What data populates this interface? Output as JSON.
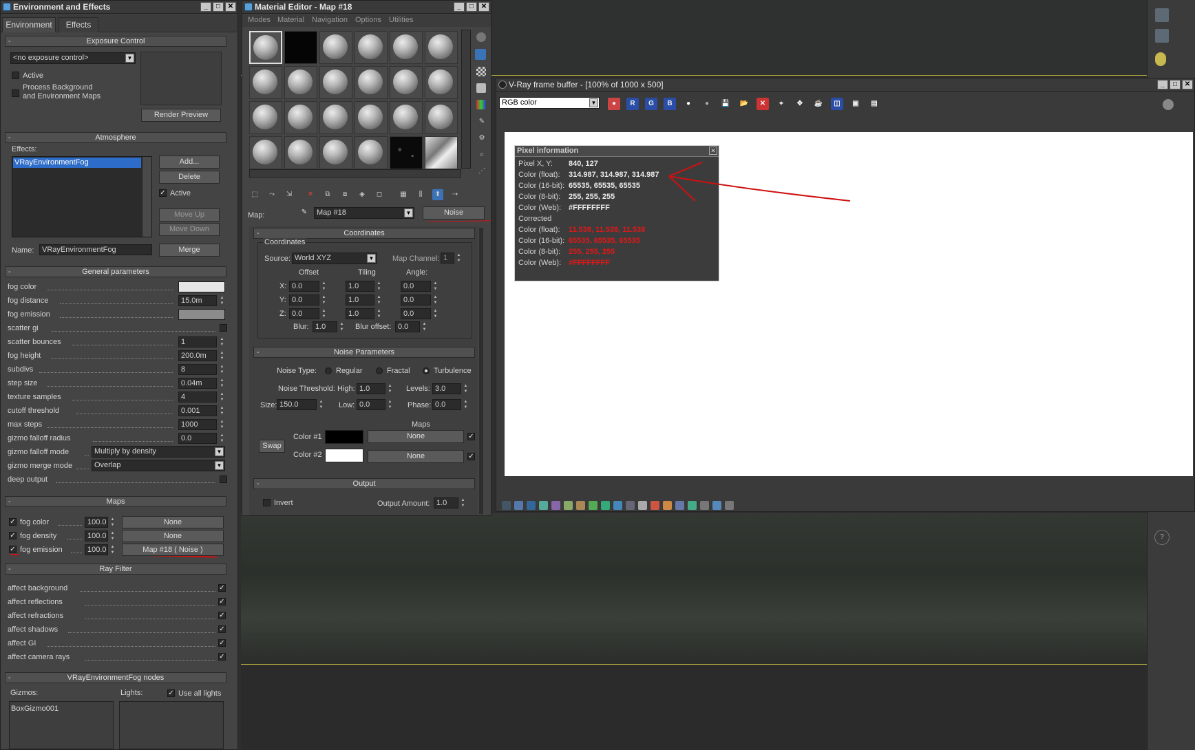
{
  "env": {
    "title": "Environment and Effects",
    "tabs": [
      "Environment",
      "Effects"
    ],
    "exposure": {
      "header": "Exposure Control",
      "dropdown": "<no exposure control>",
      "active": "Active",
      "process_bg": [
        "Process Background",
        "and Environment Maps"
      ],
      "render_preview": "Render Preview"
    },
    "atmosphere": {
      "header": "Atmosphere",
      "effects_label": "Effects:",
      "list_item": "VRayEnvironmentFog",
      "buttons": [
        "Add...",
        "Delete",
        "Move Up",
        "Move Down",
        "Merge"
      ],
      "active": "Active",
      "name_label": "Name:",
      "name_value": "VRayEnvironmentFog"
    },
    "general": {
      "header": "General parameters",
      "params": [
        {
          "label": "fog color",
          "kind": "color",
          "color": "#e6e6e6"
        },
        {
          "label": "fog distance",
          "kind": "num",
          "value": "15.0m"
        },
        {
          "label": "fog emission",
          "kind": "color",
          "color": "#8c8c8c"
        },
        {
          "label": "scatter gi",
          "kind": "check",
          "checked": false
        },
        {
          "label": "scatter bounces",
          "kind": "num",
          "value": "1"
        },
        {
          "label": "fog height",
          "kind": "num",
          "value": "200.0m"
        },
        {
          "label": "subdivs",
          "kind": "num",
          "value": "8"
        },
        {
          "label": "step size",
          "kind": "num",
          "value": "0.04m"
        },
        {
          "label": "texture samples",
          "kind": "num",
          "value": "4"
        },
        {
          "label": "cutoff threshold",
          "kind": "num",
          "value": "0.001"
        },
        {
          "label": "max steps",
          "kind": "num",
          "value": "1000"
        },
        {
          "label": "gizmo falloff radius",
          "kind": "num",
          "value": "0.0"
        },
        {
          "label": "gizmo falloff mode",
          "kind": "dd",
          "value": "Multiply by density"
        },
        {
          "label": "gizmo merge mode",
          "kind": "dd",
          "value": "Overlap"
        },
        {
          "label": "deep output",
          "kind": "check",
          "checked": false
        }
      ]
    },
    "maps": {
      "header": "Maps",
      "rows": [
        {
          "label": "fog color",
          "amount": "100.0",
          "map": "None"
        },
        {
          "label": "fog density",
          "amount": "100.0",
          "map": "None"
        },
        {
          "label": "fog emission",
          "amount": "100.0",
          "map": "Map #18  ( Noise )"
        }
      ]
    },
    "rayfilter": {
      "header": "Ray Filter",
      "rows": [
        "affect background",
        "affect reflections",
        "affect refractions",
        "affect shadows",
        "affect GI",
        "affect camera rays"
      ]
    },
    "nodes": {
      "header": "VRayEnvironmentFog nodes",
      "gizmos_label": "Gizmos:",
      "lights_label": "Lights:",
      "use_all_lights": "Use all lights",
      "gizmo_item": "BoxGizmo001"
    }
  },
  "mat": {
    "title": "Material Editor - Map #18",
    "menu": [
      "Modes",
      "Material",
      "Navigation",
      "Options",
      "Utilities"
    ],
    "map_label": "Map:",
    "map_name": "Map #18",
    "map_type": "Noise",
    "coords": {
      "header": "Coordinates",
      "group": "Coordinates",
      "source_label": "Source:",
      "source": "World XYZ",
      "map_channel_label": "Map Channel:",
      "map_channel": "1",
      "col_heads": [
        "Offset",
        "Tiling",
        "Angle:"
      ],
      "rows": [
        {
          "axis": "X:",
          "offset": "0.0",
          "tiling": "1.0",
          "angle": "0.0"
        },
        {
          "axis": "Y:",
          "offset": "0.0",
          "tiling": "1.0",
          "angle": "0.0"
        },
        {
          "axis": "Z:",
          "offset": "0.0",
          "tiling": "1.0",
          "angle": "0.0"
        }
      ],
      "blur_label": "Blur:",
      "blur": "1.0",
      "blur_offset_label": "Blur offset:",
      "blur_offset": "0.0"
    },
    "noise": {
      "header": "Noise Parameters",
      "type_label": "Noise Type:",
      "types": [
        "Regular",
        "Fractal",
        "Turbulence"
      ],
      "threshold_label": "Noise Threshold:",
      "high_label": "High:",
      "high": "1.0",
      "levels_label": "Levels:",
      "levels": "3.0",
      "size_label": "Size:",
      "size": "150.0",
      "low_label": "Low:",
      "low": "0.0",
      "phase_label": "Phase:",
      "phase": "0.0",
      "maps_label": "Maps",
      "swap": "Swap",
      "color1_label": "Color #1",
      "color2_label": "Color #2",
      "color1": "#000000",
      "color2": "#ffffff",
      "none": "None"
    },
    "output": {
      "header": "Output",
      "invert": "Invert",
      "amount_label": "Output Amount:",
      "amount": "1.0"
    }
  },
  "vfb": {
    "title": "V-Ray frame buffer - [100% of 1000 x 500]",
    "channel": "RGB color",
    "pixel_info": {
      "title": "Pixel information",
      "rows": [
        {
          "label": "Pixel X, Y:",
          "value": "840, 127"
        },
        {
          "label": "Color (float):",
          "value": "314.987, 314.987, 314.987"
        },
        {
          "label": "Color (16-bit):",
          "value": "65535, 65535, 65535"
        },
        {
          "label": "Color (8-bit):",
          "value": "255, 255, 255"
        },
        {
          "label": "Color (Web):",
          "value": "#FFFFFFFF"
        }
      ],
      "corrected_label": "Corrected",
      "corrected_rows": [
        {
          "label": "Color (float):",
          "value": "11.538, 11.538, 11.538"
        },
        {
          "label": "Color (16-bit):",
          "value": "65535, 65535, 65535"
        },
        {
          "label": "Color (8-bit):",
          "value": "255, 255, 255"
        },
        {
          "label": "Color (Web):",
          "value": "#FFFFFFFF"
        }
      ]
    }
  }
}
